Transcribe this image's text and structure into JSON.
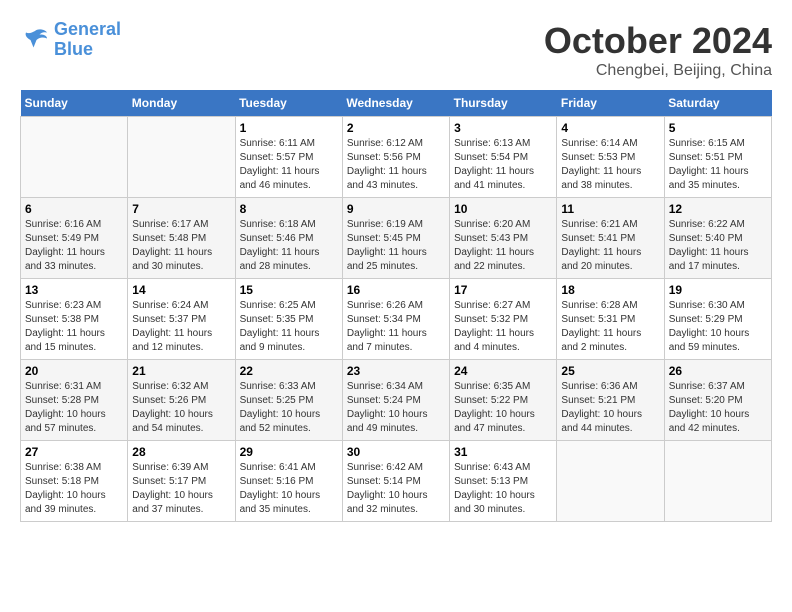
{
  "header": {
    "logo_line1": "General",
    "logo_line2": "Blue",
    "month_title": "October 2024",
    "location": "Chengbei, Beijing, China"
  },
  "weekdays": [
    "Sunday",
    "Monday",
    "Tuesday",
    "Wednesday",
    "Thursday",
    "Friday",
    "Saturday"
  ],
  "weeks": [
    [
      {
        "day": "",
        "sunrise": "",
        "sunset": "",
        "daylight": ""
      },
      {
        "day": "",
        "sunrise": "",
        "sunset": "",
        "daylight": ""
      },
      {
        "day": "1",
        "sunrise": "Sunrise: 6:11 AM",
        "sunset": "Sunset: 5:57 PM",
        "daylight": "Daylight: 11 hours and 46 minutes."
      },
      {
        "day": "2",
        "sunrise": "Sunrise: 6:12 AM",
        "sunset": "Sunset: 5:56 PM",
        "daylight": "Daylight: 11 hours and 43 minutes."
      },
      {
        "day": "3",
        "sunrise": "Sunrise: 6:13 AM",
        "sunset": "Sunset: 5:54 PM",
        "daylight": "Daylight: 11 hours and 41 minutes."
      },
      {
        "day": "4",
        "sunrise": "Sunrise: 6:14 AM",
        "sunset": "Sunset: 5:53 PM",
        "daylight": "Daylight: 11 hours and 38 minutes."
      },
      {
        "day": "5",
        "sunrise": "Sunrise: 6:15 AM",
        "sunset": "Sunset: 5:51 PM",
        "daylight": "Daylight: 11 hours and 35 minutes."
      }
    ],
    [
      {
        "day": "6",
        "sunrise": "Sunrise: 6:16 AM",
        "sunset": "Sunset: 5:49 PM",
        "daylight": "Daylight: 11 hours and 33 minutes."
      },
      {
        "day": "7",
        "sunrise": "Sunrise: 6:17 AM",
        "sunset": "Sunset: 5:48 PM",
        "daylight": "Daylight: 11 hours and 30 minutes."
      },
      {
        "day": "8",
        "sunrise": "Sunrise: 6:18 AM",
        "sunset": "Sunset: 5:46 PM",
        "daylight": "Daylight: 11 hours and 28 minutes."
      },
      {
        "day": "9",
        "sunrise": "Sunrise: 6:19 AM",
        "sunset": "Sunset: 5:45 PM",
        "daylight": "Daylight: 11 hours and 25 minutes."
      },
      {
        "day": "10",
        "sunrise": "Sunrise: 6:20 AM",
        "sunset": "Sunset: 5:43 PM",
        "daylight": "Daylight: 11 hours and 22 minutes."
      },
      {
        "day": "11",
        "sunrise": "Sunrise: 6:21 AM",
        "sunset": "Sunset: 5:41 PM",
        "daylight": "Daylight: 11 hours and 20 minutes."
      },
      {
        "day": "12",
        "sunrise": "Sunrise: 6:22 AM",
        "sunset": "Sunset: 5:40 PM",
        "daylight": "Daylight: 11 hours and 17 minutes."
      }
    ],
    [
      {
        "day": "13",
        "sunrise": "Sunrise: 6:23 AM",
        "sunset": "Sunset: 5:38 PM",
        "daylight": "Daylight: 11 hours and 15 minutes."
      },
      {
        "day": "14",
        "sunrise": "Sunrise: 6:24 AM",
        "sunset": "Sunset: 5:37 PM",
        "daylight": "Daylight: 11 hours and 12 minutes."
      },
      {
        "day": "15",
        "sunrise": "Sunrise: 6:25 AM",
        "sunset": "Sunset: 5:35 PM",
        "daylight": "Daylight: 11 hours and 9 minutes."
      },
      {
        "day": "16",
        "sunrise": "Sunrise: 6:26 AM",
        "sunset": "Sunset: 5:34 PM",
        "daylight": "Daylight: 11 hours and 7 minutes."
      },
      {
        "day": "17",
        "sunrise": "Sunrise: 6:27 AM",
        "sunset": "Sunset: 5:32 PM",
        "daylight": "Daylight: 11 hours and 4 minutes."
      },
      {
        "day": "18",
        "sunrise": "Sunrise: 6:28 AM",
        "sunset": "Sunset: 5:31 PM",
        "daylight": "Daylight: 11 hours and 2 minutes."
      },
      {
        "day": "19",
        "sunrise": "Sunrise: 6:30 AM",
        "sunset": "Sunset: 5:29 PM",
        "daylight": "Daylight: 10 hours and 59 minutes."
      }
    ],
    [
      {
        "day": "20",
        "sunrise": "Sunrise: 6:31 AM",
        "sunset": "Sunset: 5:28 PM",
        "daylight": "Daylight: 10 hours and 57 minutes."
      },
      {
        "day": "21",
        "sunrise": "Sunrise: 6:32 AM",
        "sunset": "Sunset: 5:26 PM",
        "daylight": "Daylight: 10 hours and 54 minutes."
      },
      {
        "day": "22",
        "sunrise": "Sunrise: 6:33 AM",
        "sunset": "Sunset: 5:25 PM",
        "daylight": "Daylight: 10 hours and 52 minutes."
      },
      {
        "day": "23",
        "sunrise": "Sunrise: 6:34 AM",
        "sunset": "Sunset: 5:24 PM",
        "daylight": "Daylight: 10 hours and 49 minutes."
      },
      {
        "day": "24",
        "sunrise": "Sunrise: 6:35 AM",
        "sunset": "Sunset: 5:22 PM",
        "daylight": "Daylight: 10 hours and 47 minutes."
      },
      {
        "day": "25",
        "sunrise": "Sunrise: 6:36 AM",
        "sunset": "Sunset: 5:21 PM",
        "daylight": "Daylight: 10 hours and 44 minutes."
      },
      {
        "day": "26",
        "sunrise": "Sunrise: 6:37 AM",
        "sunset": "Sunset: 5:20 PM",
        "daylight": "Daylight: 10 hours and 42 minutes."
      }
    ],
    [
      {
        "day": "27",
        "sunrise": "Sunrise: 6:38 AM",
        "sunset": "Sunset: 5:18 PM",
        "daylight": "Daylight: 10 hours and 39 minutes."
      },
      {
        "day": "28",
        "sunrise": "Sunrise: 6:39 AM",
        "sunset": "Sunset: 5:17 PM",
        "daylight": "Daylight: 10 hours and 37 minutes."
      },
      {
        "day": "29",
        "sunrise": "Sunrise: 6:41 AM",
        "sunset": "Sunset: 5:16 PM",
        "daylight": "Daylight: 10 hours and 35 minutes."
      },
      {
        "day": "30",
        "sunrise": "Sunrise: 6:42 AM",
        "sunset": "Sunset: 5:14 PM",
        "daylight": "Daylight: 10 hours and 32 minutes."
      },
      {
        "day": "31",
        "sunrise": "Sunrise: 6:43 AM",
        "sunset": "Sunset: 5:13 PM",
        "daylight": "Daylight: 10 hours and 30 minutes."
      },
      {
        "day": "",
        "sunrise": "",
        "sunset": "",
        "daylight": ""
      },
      {
        "day": "",
        "sunrise": "",
        "sunset": "",
        "daylight": ""
      }
    ]
  ]
}
